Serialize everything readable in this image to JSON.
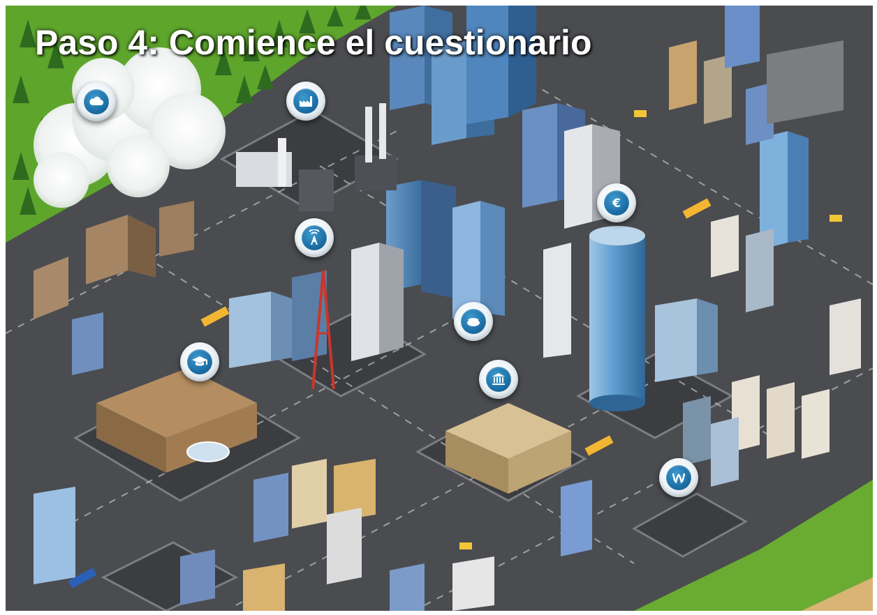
{
  "title": "Paso 4: Comience el cuestionario",
  "colors": {
    "grass": "#5fa82e",
    "road": "#4a4a4e",
    "hotspot_blue": "#1c6fa6",
    "title_text": "#ffffff"
  },
  "hotspots": [
    {
      "name": "cloud-hotspot",
      "icon": "cloud-icon"
    },
    {
      "name": "factory-hotspot",
      "icon": "factory-icon"
    },
    {
      "name": "euro-hotspot",
      "icon": "euro-icon"
    },
    {
      "name": "antenna-hotspot",
      "icon": "antenna-icon"
    },
    {
      "name": "network-hotspot",
      "icon": "network-icon"
    },
    {
      "name": "graduation-hotspot",
      "icon": "graduation-cap-icon"
    },
    {
      "name": "government-hotspot",
      "icon": "government-building-icon"
    },
    {
      "name": "water-hotspot",
      "icon": "water-icon"
    }
  ]
}
